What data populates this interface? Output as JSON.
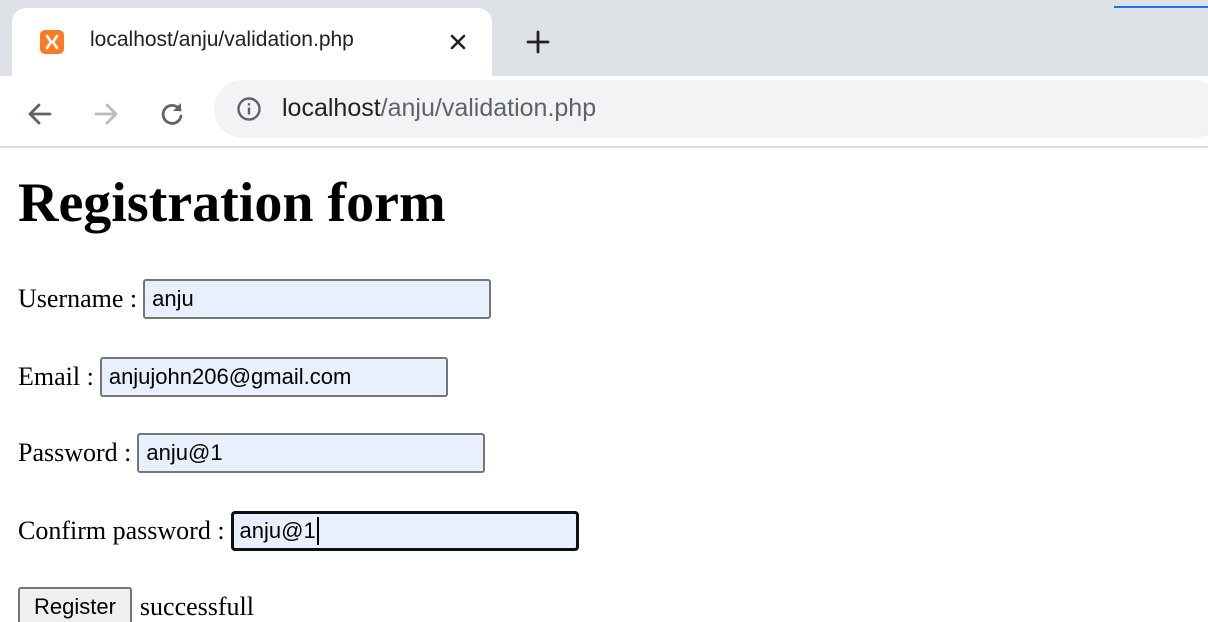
{
  "browser": {
    "tab": {
      "title": "localhost/anju/validation.php",
      "favicon": "xampp-icon"
    },
    "omnibox": {
      "host": "localhost",
      "path": "/anju/validation.php"
    },
    "colors": {
      "tabstrip": "#dee1e6",
      "accent": "#1a73e8",
      "favicon": "#fb7a24",
      "autofill": "#e8f0fe"
    }
  },
  "page": {
    "title": "Registration form",
    "form": {
      "username": {
        "label": "Username :",
        "value": "anju"
      },
      "email": {
        "label": "Email :",
        "value": "anjujohn206@gmail.com"
      },
      "password": {
        "label": "Password :",
        "value": "anju@1"
      },
      "confirm_password": {
        "label": "Confirm password :",
        "value": "anju@1"
      },
      "submit_label": "Register",
      "status": "successfull"
    }
  }
}
